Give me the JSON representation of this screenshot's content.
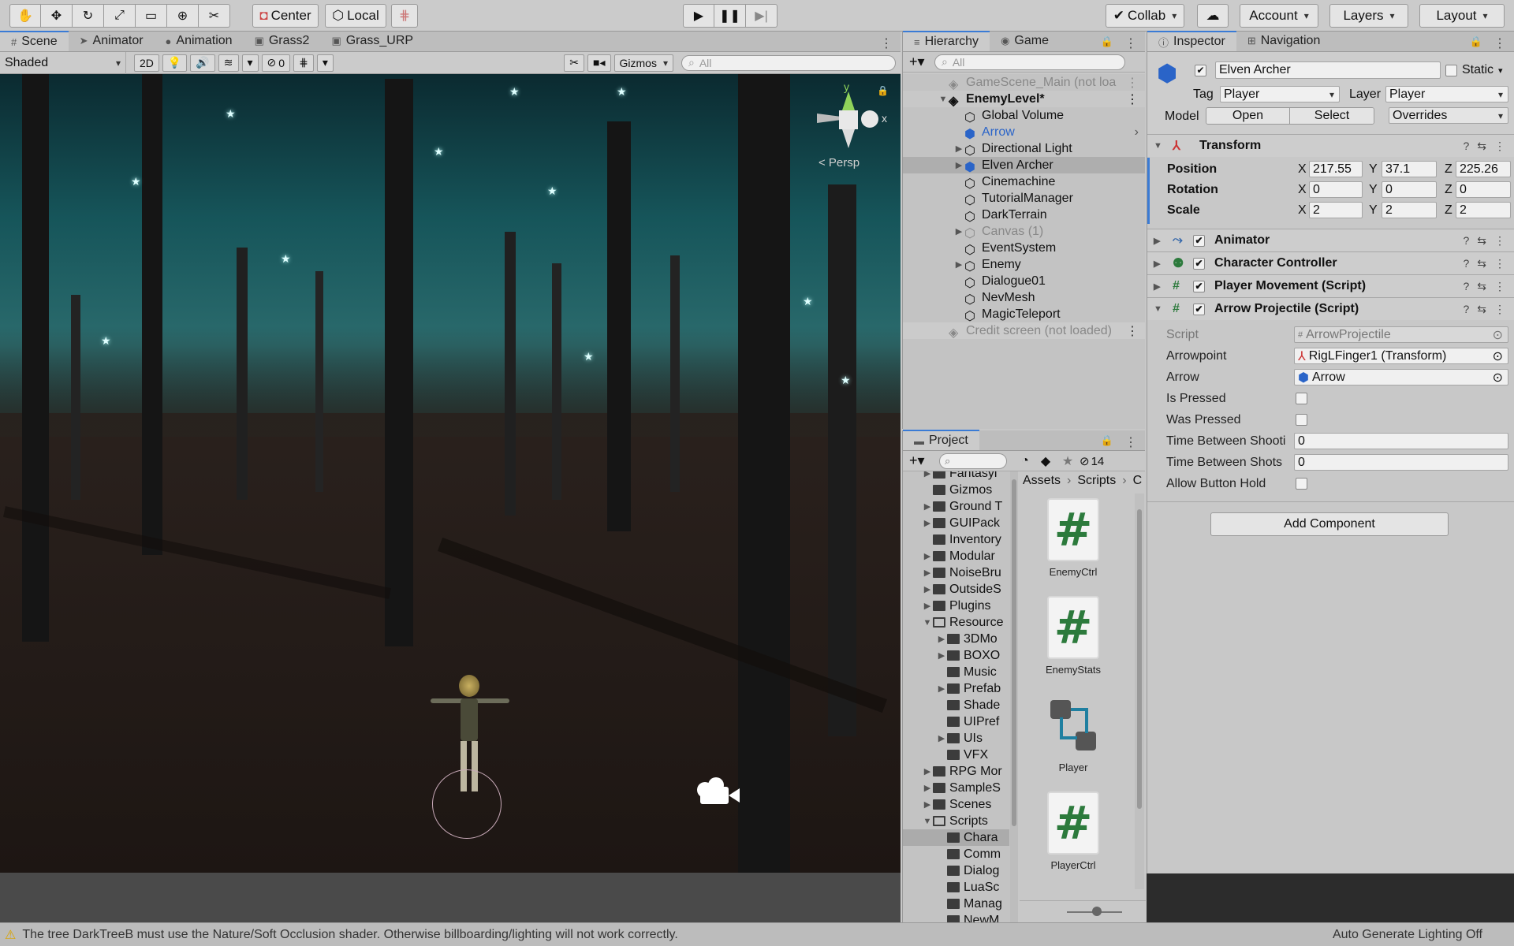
{
  "toolbar": {
    "pivot": "Center",
    "space": "Local",
    "collab": "Collab",
    "account": "Account",
    "layers": "Layers",
    "layout": "Layout"
  },
  "scene": {
    "tabs": [
      "Scene",
      "Animator",
      "Animation",
      "Grass2",
      "Grass_URP"
    ],
    "shading": "Shaded",
    "mode2d": "2D",
    "hidden_count": "0",
    "gizmos": "Gizmos",
    "search_placeholder": "All",
    "persp_label": "< Persp",
    "axis_y": "y",
    "axis_x": "x"
  },
  "hierarchy": {
    "tabs": [
      "Hierarchy",
      "Game"
    ],
    "search_placeholder": "All",
    "rows": [
      "GameScene_Main (not loa",
      "EnemyLevel*",
      "Global Volume",
      "Arrow",
      "Directional Light",
      "Elven Archer",
      "Cinemachine",
      "TutorialManager",
      "DarkTerrain",
      "Canvas (1)",
      "EventSystem",
      "Enemy",
      "Dialogue01",
      "NevMesh",
      "MagicTeleport",
      "Credit screen (not loaded)"
    ]
  },
  "project": {
    "tab": "Project",
    "badge_count": "14",
    "folders": [
      "Fantasyl",
      "Gizmos",
      "Ground T",
      "GUIPack",
      "Inventory",
      "Modular",
      "NoiseBru",
      "OutsideS",
      "Plugins",
      "Resource",
      "3DMo",
      "BOXO",
      "Music",
      "Prefab",
      "Shade",
      "UIPref",
      "UIs",
      "VFX",
      "RPG Mor",
      "SampleS",
      "Scenes",
      "Scripts",
      "Chara",
      "Comm",
      "Dialog",
      "LuaSc",
      "Manag",
      "NewM"
    ],
    "breadcrumb": [
      "Assets",
      "Scripts",
      "C"
    ],
    "assets": [
      "EnemyCtrl",
      "EnemyStats",
      "Player",
      "PlayerCtrl"
    ]
  },
  "inspector": {
    "tabs": [
      "Inspector",
      "Navigation"
    ],
    "object_name": "Elven Archer",
    "static_label": "Static",
    "tag_label": "Tag",
    "tag_value": "Player",
    "layer_label": "Layer",
    "layer_value": "Player",
    "model_label": "Model",
    "open_btn": "Open",
    "select_btn": "Select",
    "overrides": "Overrides",
    "transform": {
      "title": "Transform",
      "position_label": "Position",
      "rotation_label": "Rotation",
      "scale_label": "Scale",
      "position": [
        "217.55",
        "37.1",
        "225.26"
      ],
      "rotation": [
        "0",
        "0",
        "0"
      ],
      "scale": [
        "2",
        "2",
        "2"
      ]
    },
    "axes": [
      "X",
      "Y",
      "Z"
    ],
    "components": [
      "Animator",
      "Character Controller",
      "Player Movement (Script)",
      "Arrow Projectile (Script)"
    ],
    "arrow_projectile": {
      "script_label": "Script",
      "script_value": "ArrowProjectile",
      "arrowpoint_label": "Arrowpoint",
      "arrowpoint_value": "RigLFinger1 (Transform)",
      "arrow_label": "Arrow",
      "arrow_value": "Arrow",
      "is_pressed_label": "Is Pressed",
      "was_pressed_label": "Was Pressed",
      "time_between_shooting_label": "Time Between Shooti",
      "time_between_shooting_value": "0",
      "time_between_shots_label": "Time Between Shots",
      "time_between_shots_value": "0",
      "allow_button_hold_label": "Allow Button Hold"
    },
    "add_component": "Add Component"
  },
  "status": {
    "warning": "The tree DarkTreeB must use the Nature/Soft Occlusion shader. Otherwise billboarding/lighting will not work correctly.",
    "lighting": "Auto Generate Lighting Off"
  },
  "colors": {
    "selection_blue": "#3a7bd5",
    "prefab_blue": "#2a64c8",
    "script_green": "#2c7a3c"
  }
}
